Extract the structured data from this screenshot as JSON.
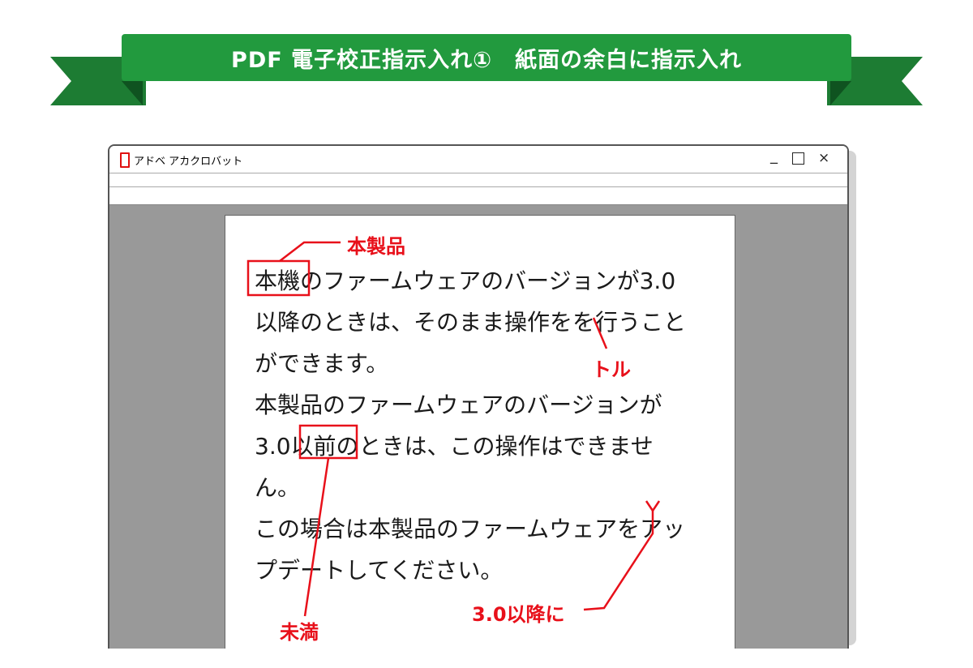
{
  "banner": {
    "title": "PDF 電子校正指示入れ①　紙面の余白に指示入れ"
  },
  "window": {
    "title": "アドベ アカクロバット",
    "controls": {
      "minimize": "_",
      "maximize": "",
      "close": "×"
    }
  },
  "document": {
    "lines": [
      [
        "本機",
        "のファームウェアのバージョンが3.0"
      ],
      [
        "以降のときは、そのまま操作をを行うこと"
      ],
      [
        "ができます。"
      ],
      [
        "本製品のファームウェアのバージョンが"
      ],
      [
        "3.0",
        "以前",
        "のときは、この操作はできませ"
      ],
      [
        "ん。"
      ],
      [
        "この場合は本製品のファームウェアをアッ"
      ],
      [
        "プデートしてください。"
      ]
    ]
  },
  "annotations": {
    "replace_1": "本製品",
    "delete": "トル",
    "replace_2": "未満",
    "insert": "3.0以降に"
  },
  "colors": {
    "ribbon": "#229a3e",
    "ribbon_dark": "#1d7c33",
    "annotation": "#e8101a",
    "viewport": "#999999"
  }
}
